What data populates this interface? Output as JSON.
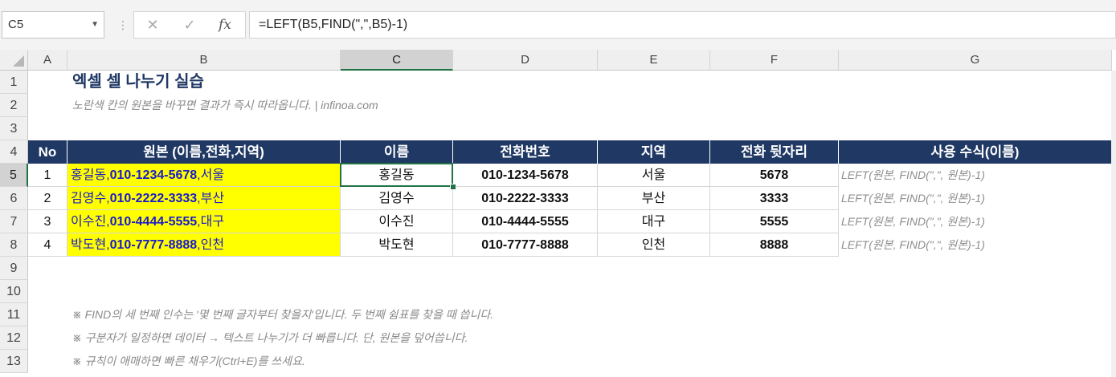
{
  "formula_bar": {
    "name_box": "C5",
    "cancel_icon": "✕",
    "enter_icon": "✓",
    "fx_label": "fx",
    "formula": "=LEFT(B5,FIND(\",\",B5)-1)"
  },
  "columns": [
    "A",
    "B",
    "C",
    "D",
    "E",
    "F",
    "G"
  ],
  "rows": [
    "1",
    "2",
    "3",
    "4",
    "5",
    "6",
    "7",
    "8",
    "9",
    "10",
    "11",
    "12",
    "13"
  ],
  "selected": {
    "column": "C",
    "row": "5"
  },
  "sheet": {
    "title": "엑셀 셀 나누기 실습",
    "subtitle": "노란색 칸의 원본을 바꾸면 결과가 즉시 따라옵니다.  |  infinoa.com",
    "headers": [
      "No",
      "원본 (이름,전화,지역)",
      "이름",
      "전화번호",
      "지역",
      "전화 뒷자리",
      "사용 수식(이름)"
    ],
    "records": [
      {
        "no": "1",
        "src_name": "홍길동",
        "src_phone": "010-1234-5678",
        "src_region": "서울",
        "sep": ",",
        "name": "홍길동",
        "phone": "010-1234-5678",
        "region": "서울",
        "last4": "5678",
        "formula": "LEFT(원본, FIND(\",\", 원본)-1)"
      },
      {
        "no": "2",
        "src_name": "김영수",
        "src_phone": "010-2222-3333",
        "src_region": "부산",
        "sep": ",",
        "name": "김영수",
        "phone": "010-2222-3333",
        "region": "부산",
        "last4": "3333",
        "formula": "LEFT(원본, FIND(\",\", 원본)-1)"
      },
      {
        "no": "3",
        "src_name": "이수진",
        "src_phone": "010-4444-5555",
        "src_region": "대구",
        "sep": ",",
        "name": "이수진",
        "phone": "010-4444-5555",
        "region": "대구",
        "last4": "5555",
        "formula": "LEFT(원본, FIND(\",\", 원본)-1)"
      },
      {
        "no": "4",
        "src_name": "박도현",
        "src_phone": "010-7777-8888",
        "src_region": "인천",
        "sep": ",",
        "name": "박도현",
        "phone": "010-7777-8888",
        "region": "인천",
        "last4": "8888",
        "formula": "LEFT(원본, FIND(\",\", 원본)-1)"
      }
    ],
    "notes": [
      "※ FIND의 세 번째 인수는 '몇 번째 글자부터 찾을지'입니다. 두 번째 쉼표를 찾을 때 씁니다.",
      "※ 구분자가 일정하면 데이터 → 텍스트 나누기가 더 빠릅니다. 단, 원본을 덮어씁니다.",
      "※ 규칙이 애매하면 빠른 채우기(Ctrl+E)를 쓰세요."
    ]
  },
  "colors": {
    "header_bg": "#1f3864",
    "source_bg": "#ffff00",
    "source_text": "#1a1acf",
    "accent": "#217346"
  }
}
